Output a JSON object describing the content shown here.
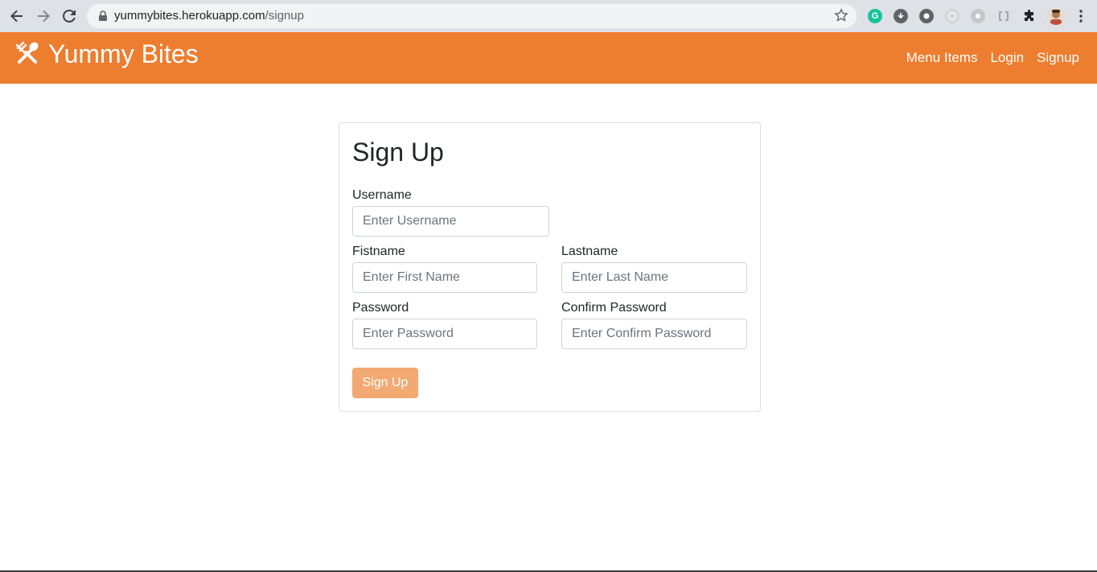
{
  "browser": {
    "url_host": "yummybites.herokuapp.com",
    "url_path": "/signup"
  },
  "navbar": {
    "brand": "Yummy Bites",
    "brand_icon": "fork-spoon-icon",
    "links": [
      {
        "label": "Menu Items"
      },
      {
        "label": "Login"
      },
      {
        "label": "Signup"
      }
    ],
    "background_color": "#ed7d2f"
  },
  "form": {
    "title": "Sign Up",
    "username": {
      "label": "Username",
      "placeholder": "Enter Username",
      "value": ""
    },
    "firstname": {
      "label": "Fistname",
      "placeholder": "Enter First Name",
      "value": ""
    },
    "lastname": {
      "label": "Lastname",
      "placeholder": "Enter Last Name",
      "value": ""
    },
    "password": {
      "label": "Password",
      "placeholder": "Enter Password",
      "value": ""
    },
    "confirm_password": {
      "label": "Confirm Password",
      "placeholder": "Enter Confirm Password",
      "value": ""
    },
    "submit_label": "Sign Up",
    "submit_color": "#f2a972"
  }
}
